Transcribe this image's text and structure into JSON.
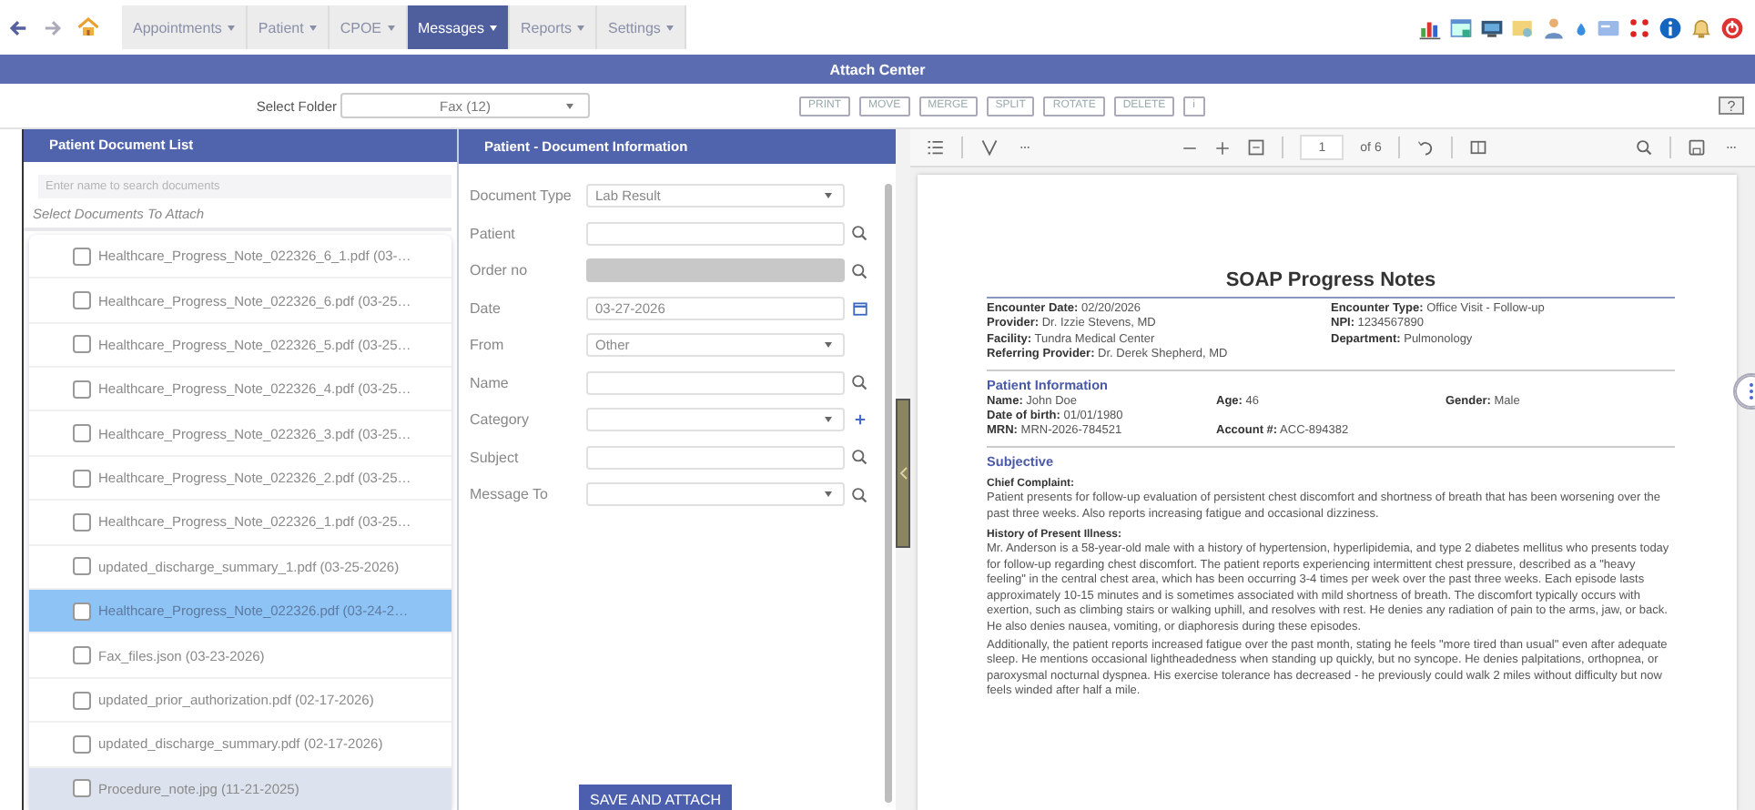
{
  "nav": {
    "menus": [
      {
        "label": "Appointments",
        "selected": false
      },
      {
        "label": "Patient",
        "selected": false
      },
      {
        "label": "CPOE",
        "selected": false
      },
      {
        "label": "Messages",
        "selected": true
      },
      {
        "label": "Reports",
        "selected": false
      },
      {
        "label": "Settings",
        "selected": false
      }
    ]
  },
  "window": {
    "title": "Attach Center"
  },
  "folder": {
    "label": "Select Folder",
    "value": "Fax (12)"
  },
  "toolbar": {
    "buttons": [
      "PRINT",
      "MOVE",
      "MERGE",
      "SPLIT",
      "ROTATE",
      "DELETE"
    ],
    "info_label": "i",
    "help_label": "?"
  },
  "document_list": {
    "title": "Patient Document List",
    "search_placeholder": "Enter name to search documents",
    "caption": "Select Documents To Attach",
    "items": [
      {
        "label": "Healthcare_Progress_Note_022326_6_1.pdf (03-…",
        "selected": false,
        "highlighted": false,
        "checked": false
      },
      {
        "label": "Healthcare_Progress_Note_022326_6.pdf (03-25…",
        "selected": false,
        "highlighted": false,
        "checked": false
      },
      {
        "label": "Healthcare_Progress_Note_022326_5.pdf (03-25…",
        "selected": false,
        "highlighted": false,
        "checked": false
      },
      {
        "label": "Healthcare_Progress_Note_022326_4.pdf (03-25…",
        "selected": false,
        "highlighted": false,
        "checked": false
      },
      {
        "label": "Healthcare_Progress_Note_022326_3.pdf (03-25…",
        "selected": false,
        "highlighted": false,
        "checked": false
      },
      {
        "label": "Healthcare_Progress_Note_022326_2.pdf (03-25…",
        "selected": false,
        "highlighted": false,
        "checked": false
      },
      {
        "label": "Healthcare_Progress_Note_022326_1.pdf (03-25…",
        "selected": false,
        "highlighted": false,
        "checked": false
      },
      {
        "label": "updated_discharge_summary_1.pdf (03-25-2026)",
        "selected": false,
        "highlighted": false,
        "checked": false
      },
      {
        "label": "Healthcare_Progress_Note_022326.pdf (03-24-2…",
        "selected": true,
        "highlighted": false,
        "checked": false
      },
      {
        "label": "Fax_files.json (03-23-2026)",
        "selected": false,
        "highlighted": false,
        "checked": false
      },
      {
        "label": "updated_prior_authorization.pdf (02-17-2026)",
        "selected": false,
        "highlighted": false,
        "checked": false
      },
      {
        "label": "updated_discharge_summary.pdf (02-17-2026)",
        "selected": false,
        "highlighted": false,
        "checked": false
      },
      {
        "label": "Procedure_note.jpg (11-21-2025)",
        "selected": false,
        "highlighted": true,
        "checked": false
      }
    ]
  },
  "document_info": {
    "title": "Patient - Document Information",
    "fields": [
      {
        "label": "Document Type",
        "kind": "select",
        "value": "Lab Result",
        "disabled": false
      },
      {
        "label": "Patient",
        "kind": "search",
        "disabled": false
      },
      {
        "label": "Order no",
        "kind": "search",
        "disabled": true
      },
      {
        "label": "Date",
        "kind": "date",
        "value": "03-27-2026",
        "disabled": false
      },
      {
        "label": "From",
        "kind": "select",
        "value": "Other",
        "disabled": false
      },
      {
        "label": "Name",
        "kind": "search",
        "disabled": false
      },
      {
        "label": "Category",
        "kind": "select-add",
        "disabled": false
      },
      {
        "label": "Subject",
        "kind": "search",
        "disabled": false
      },
      {
        "label": "Message To",
        "kind": "select-search",
        "disabled": false
      }
    ],
    "save_button": "SAVE AND ATTACH"
  },
  "viewer": {
    "page": "1",
    "page_count": "of 6",
    "document": {
      "title": "SOAP Progress Notes",
      "encounter": [
        "**Encounter Date:** 02/20/2026",
        "**Encounter Type:** Office Visit - Follow-up",
        "**Provider:** Dr. Izzie Stevens, MD",
        "**NPI:** 1234567890",
        "**Facility:** Tundra Medical Center",
        "**Department:** Pulmonology",
        "**Referring Provider:** Dr. Derek Shepherd, MD"
      ],
      "patient_heading": "Patient Information",
      "patient_rows": [
        [
          "**Name:** John Doe",
          "**Age:** 46",
          "**Gender:** Male"
        ],
        [
          "**Date of birth:** 01/01/1980"
        ],
        [
          "**MRN:** MRN-2026-784521",
          "**Account #:** ACC-894382"
        ]
      ],
      "section_heading": "Subjective",
      "blocks": [
        {
          "heading": "Chief Complaint:",
          "paragraphs": [
            "Patient presents for follow-up evaluation of persistent chest discomfort and shortness of breath that has been worsening over the past three weeks. Also reports increasing fatigue and occasional dizziness."
          ]
        },
        {
          "heading": "History of Present Illness:",
          "paragraphs": [
            "Mr. Anderson is a 58-year-old male with a history of hypertension, hyperlipidemia, and type 2 diabetes mellitus who presents today for follow-up regarding chest discomfort. The patient reports experiencing intermittent chest pressure, described as a \"heavy feeling\" in the central chest area, which has been occurring 3-4 times per week over the past three weeks. Each episode lasts approximately 10-15 minutes and is sometimes associated with mild shortness of breath. The discomfort typically occurs with exertion, such as climbing stairs or walking uphill, and resolves with rest. He denies any radiation of pain to the arms, jaw, or back. He also denies nausea, vomiting, or diaphoresis during these episodes.",
            "Additionally, the patient reports increased fatigue over the past month, stating he feels \"more tired than usual\" even after adequate sleep. He mentions occasional lightheadedness when standing up quickly, but no syncope. He denies palpitations, orthopnea, or paroxysmal nocturnal dyspnea. His exercise tolerance has decreased - he previously could walk 2 miles without difficulty but now feels winded after half a mile."
          ]
        }
      ]
    }
  }
}
